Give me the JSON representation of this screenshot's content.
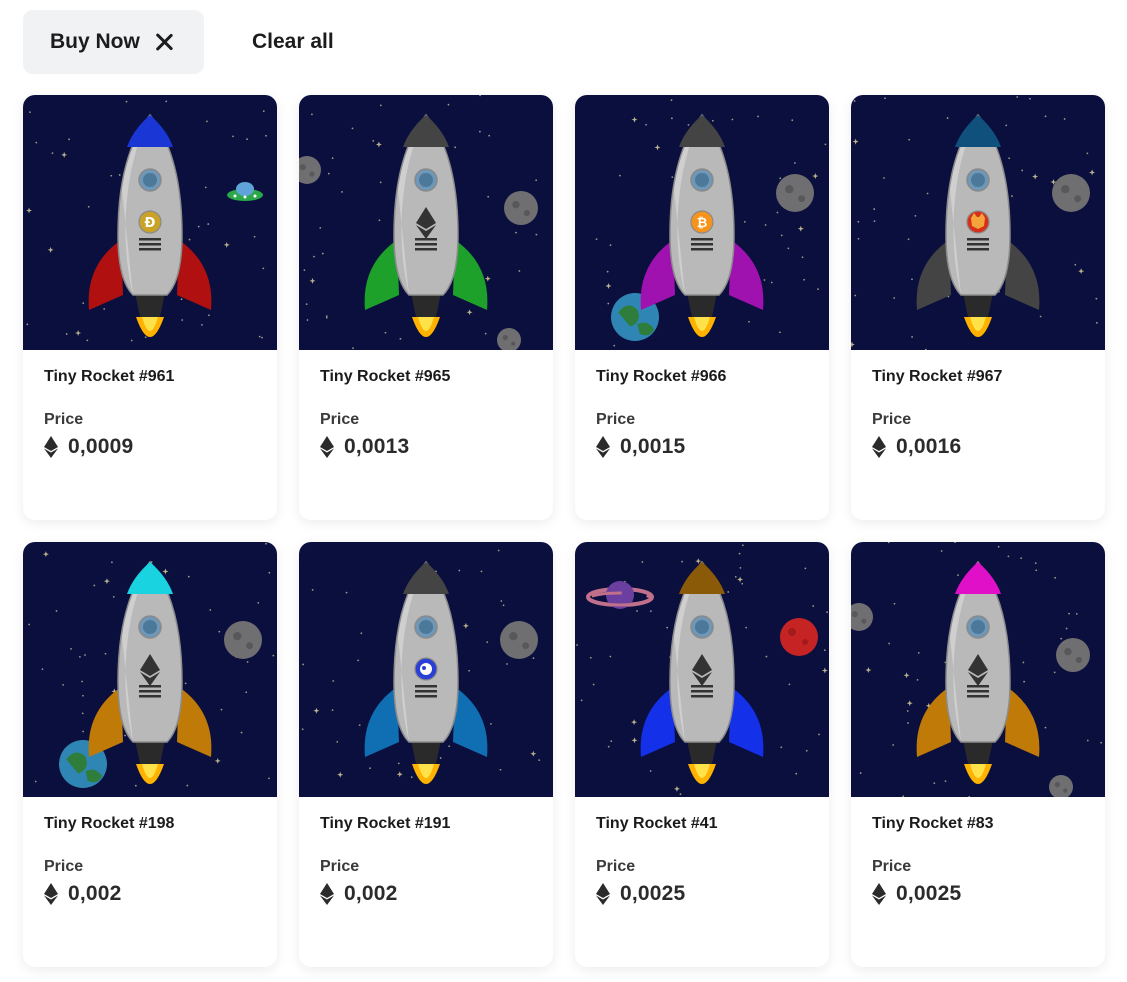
{
  "filters": {
    "active_chip_label": "Buy Now",
    "clear_all_label": "Clear all"
  },
  "price_label": "Price",
  "currency_icon": "ethereum-icon",
  "cards": [
    {
      "name": "Tiny Rocket #961",
      "price": "0,0009",
      "nose": "#1a37d6",
      "fins": "#b01010",
      "coin": "dogecoin-icon",
      "coin_color": "#c9a227",
      "extra": "ufo"
    },
    {
      "name": "Tiny Rocket #965",
      "price": "0,0013",
      "nose": "#444444",
      "fins": "#1ea12a",
      "coin": "ethereum-icon",
      "coin_color": "#bdbdbd",
      "extra": "asteroids"
    },
    {
      "name": "Tiny Rocket #966",
      "price": "0,0015",
      "nose": "#444444",
      "fins": "#a012b0",
      "coin": "bitcoin-icon",
      "coin_color": "#f7931a",
      "extra": "planet-asteroid"
    },
    {
      "name": "Tiny Rocket #967",
      "price": "0,0016",
      "nose": "#10507d",
      "fins": "#444444",
      "coin": "shiba-icon",
      "coin_color": "#d6301a",
      "extra": "asteroid"
    },
    {
      "name": "Tiny Rocket #198",
      "price": "0,002",
      "nose": "#19d3e0",
      "fins": "#c07a08",
      "coin": "ethereum-icon",
      "coin_color": "#bdbdbd",
      "extra": "planet-asteroid"
    },
    {
      "name": "Tiny Rocket #191",
      "price": "0,002",
      "nose": "#444444",
      "fins": "#0f6fb2",
      "coin": "token-icon",
      "coin_color": "#2a3fd6",
      "extra": "asteroid"
    },
    {
      "name": "Tiny Rocket #41",
      "price": "0,0025",
      "nose": "#8a5a08",
      "fins": "#1430e8",
      "coin": "ethereum-icon",
      "coin_color": "#bdbdbd",
      "extra": "saturn-mars"
    },
    {
      "name": "Tiny Rocket #83",
      "price": "0,0025",
      "nose": "#e010c8",
      "fins": "#c07a08",
      "coin": "ethereum-icon",
      "coin_color": "#bdbdbd",
      "extra": "asteroids"
    }
  ]
}
